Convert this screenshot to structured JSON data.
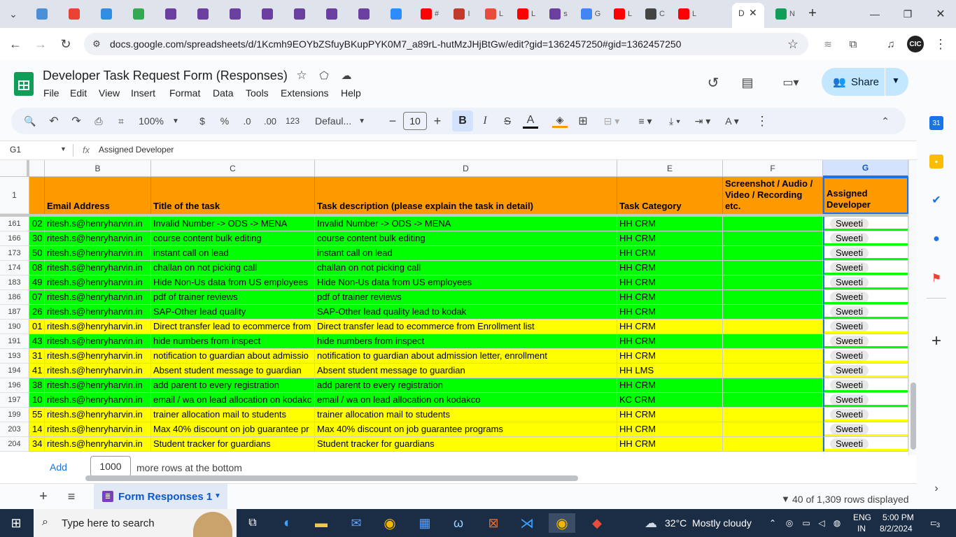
{
  "browser": {
    "tabs": [
      {
        "icon": "wordcloud-icon",
        "color": "#4a90d9",
        "label": ""
      },
      {
        "icon": "gmail-icon",
        "color": "#ea4335",
        "label": ""
      },
      {
        "icon": "teams-icon",
        "color": "#2f8de4",
        "label": ""
      },
      {
        "icon": "number-one-icon",
        "color": "#34a853",
        "label": ""
      },
      {
        "icon": "purple-h-icon",
        "color": "#6b3fa0",
        "label": ""
      },
      {
        "icon": "purple-h-icon",
        "color": "#6b3fa0",
        "label": ""
      },
      {
        "icon": "purple-h-icon",
        "color": "#6b3fa0",
        "label": ""
      },
      {
        "icon": "purple-h-icon",
        "color": "#6b3fa0",
        "label": ""
      },
      {
        "icon": "purple-h-icon",
        "color": "#6b3fa0",
        "label": ""
      },
      {
        "icon": "purple-h-icon",
        "color": "#6b3fa0",
        "label": ""
      },
      {
        "icon": "purple-h-icon",
        "color": "#6b3fa0",
        "label": ""
      },
      {
        "icon": "zoom-icon",
        "color": "#2d8cff",
        "label": ""
      },
      {
        "icon": "youtube-icon",
        "color": "#ff0000",
        "label": "#"
      },
      {
        "icon": "pma-icon",
        "color": "#c0392b",
        "label": "I"
      },
      {
        "icon": "tool-icon",
        "color": "#e74c3c",
        "label": "L"
      },
      {
        "icon": "youtube-icon",
        "color": "#ff0000",
        "label": "L"
      },
      {
        "icon": "purple-h-icon",
        "color": "#6b3fa0",
        "label": "s"
      },
      {
        "icon": "google-icon",
        "color": "#4285f4",
        "label": "G"
      },
      {
        "icon": "youtube-icon",
        "color": "#ff0000",
        "label": "L"
      },
      {
        "icon": "chatgpt-icon",
        "color": "#444444",
        "label": "C"
      },
      {
        "icon": "youtube-icon",
        "color": "#ff0000",
        "label": "L"
      },
      {
        "icon": "docs-icon",
        "color": "#444444",
        "label": "D"
      },
      {
        "icon": "sheets-icon",
        "color": "#0f9d58",
        "label": "N"
      }
    ],
    "url": "docs.google.com/spreadsheets/d/1Kcmh9EOYbZSfuyBKupPYK0M7_a89rL-hutMzJHjBtGw/edit?gid=1362457250#gid=1362457250"
  },
  "sheet": {
    "title": "Developer Task Request Form (Responses)",
    "menus": [
      "File",
      "Edit",
      "View",
      "Insert",
      "Format",
      "Data",
      "Tools",
      "Extensions",
      "Help"
    ],
    "share_label": "Share",
    "toolbar": {
      "zoom": "100%",
      "currency": "$",
      "percent": "%",
      "dec_less": ".0",
      "dec_more": ".00",
      "number_format": "123",
      "font": "Defaul...",
      "font_size": "10"
    },
    "cell_ref": "G1",
    "formula": "Assigned Developer",
    "columns": [
      "B",
      "C",
      "D",
      "E",
      "F",
      "G"
    ],
    "headers": [
      "Email Address",
      "Title of the task",
      "Task description (please explain the task in detail)",
      "Task Category",
      "Screenshot / Audio / Video / Recording etc.",
      "Assigned Developer"
    ],
    "header_row_number": "1",
    "rows": [
      {
        "num": "161",
        "a": "02",
        "b": "ritesh.s@henryharvin.in",
        "c": "Invalid Number -> ODS -> MENA",
        "d": "Invalid Number -> ODS -> MENA",
        "e": "HH CRM",
        "f": "",
        "g": "Sweeti",
        "color": "#00ff00"
      },
      {
        "num": "166",
        "a": "30",
        "b": "ritesh.s@henryharvin.in",
        "c": "course content bulk editing",
        "d": "course content bulk editing",
        "e": "HH CRM",
        "f": "",
        "g": "Sweeti",
        "color": "#00ff00"
      },
      {
        "num": "173",
        "a": "50",
        "b": "ritesh.s@henryharvin.in",
        "c": "instant call on lead",
        "d": "instant call on lead",
        "e": "HH CRM",
        "f": "",
        "g": "Sweeti",
        "color": "#00ff00"
      },
      {
        "num": "174",
        "a": "08",
        "b": "ritesh.s@henryharvin.in",
        "c": "challan on not picking call",
        "d": "challan on not picking call",
        "e": "HH CRM",
        "f": "",
        "g": "Sweeti",
        "color": "#00ff00"
      },
      {
        "num": "183",
        "a": "49",
        "b": "ritesh.s@henryharvin.in",
        "c": "Hide Non-Us data from US employees",
        "d": "Hide Non-Us data from US employees",
        "e": "HH CRM",
        "f": "",
        "g": "Sweeti",
        "color": "#00ff00"
      },
      {
        "num": "186",
        "a": "07",
        "b": "ritesh.s@henryharvin.in",
        "c": "pdf of trainer reviews",
        "d": "pdf of trainer reviews",
        "e": "HH CRM",
        "f": "",
        "g": "Sweeti",
        "color": "#00ff00"
      },
      {
        "num": "187",
        "a": "26",
        "b": "ritesh.s@henryharvin.in",
        "c": "SAP-Other lead quality",
        "d": "SAP-Other lead quality lead to kodak",
        "e": "HH CRM",
        "f": "",
        "g": "Sweeti",
        "color": "#00ff00"
      },
      {
        "num": "190",
        "a": "01",
        "b": "ritesh.s@henryharvin.in",
        "c": "Direct transfer lead to ecommerce from",
        "d": "Direct transfer lead to ecommerce from Enrollment list",
        "e": "HH CRM",
        "f": "",
        "g": "Sweeti",
        "color": "#ffff00"
      },
      {
        "num": "191",
        "a": "43",
        "b": "ritesh.s@henryharvin.in",
        "c": "hide numbers from inspect",
        "d": "hide numbers from inspect",
        "e": "HH CRM",
        "f": "",
        "g": "Sweeti",
        "color": "#00ff00"
      },
      {
        "num": "193",
        "a": "31",
        "b": "ritesh.s@henryharvin.in",
        "c": "notification to guardian about admissio",
        "d": "notification to guardian about admission letter, enrollment",
        "e": "HH CRM",
        "f": "",
        "g": "Sweeti",
        "color": "#ffff00"
      },
      {
        "num": "194",
        "a": "41",
        "b": "ritesh.s@henryharvin.in",
        "c": "Absent student message to guardian",
        "d": "Absent student message to guardian",
        "e": "HH LMS",
        "f": "",
        "g": "Sweeti",
        "color": "#ffff00"
      },
      {
        "num": "196",
        "a": "38",
        "b": "ritesh.s@henryharvin.in",
        "c": "add parent to every registration",
        "d": "add parent to every registration",
        "e": "HH CRM",
        "f": "",
        "g": "Sweeti",
        "color": "#00ff00"
      },
      {
        "num": "197",
        "a": "10",
        "b": "ritesh.s@henryharvin.in",
        "c": "email / wa on lead allocation on kodakc",
        "d": "email / wa on lead allocation on kodakco",
        "e": "KC CRM",
        "f": "",
        "g": "Sweeti",
        "color": "#00ff00"
      },
      {
        "num": "199",
        "a": "55",
        "b": "ritesh.s@henryharvin.in",
        "c": "trainer allocation mail to students",
        "d": "trainer allocation mail to students",
        "e": "HH CRM",
        "f": "",
        "g": "Sweeti",
        "color": "#ffff00"
      },
      {
        "num": "203",
        "a": "14",
        "b": "ritesh.s@henryharvin.in",
        "c": "Max 40% discount on job guarantee pr",
        "d": "Max 40% discount on job guarantee programs",
        "e": "HH CRM",
        "f": "",
        "g": "Sweeti",
        "color": "#ffff00"
      },
      {
        "num": "204",
        "a": "34",
        "b": "ritesh.s@henryharvin.in",
        "c": "Student tracker for guardians",
        "d": "Student tracker for guardians",
        "e": "HH CRM",
        "f": "",
        "g": "Sweeti",
        "color": "#ffff00"
      }
    ],
    "add_label": "Add",
    "add_count": "1000",
    "add_suffix": "more rows at the bottom",
    "sheet_tab": "Form Responses 1",
    "rows_displayed": "40 of 1,309 rows displayed"
  },
  "taskbar": {
    "search_placeholder": "Type here to search",
    "weather": "32°C  Mostly cloudy",
    "lang1": "ENG",
    "lang2": "IN",
    "time": "5:00 PM",
    "date": "8/2/2024",
    "notif": "3"
  }
}
